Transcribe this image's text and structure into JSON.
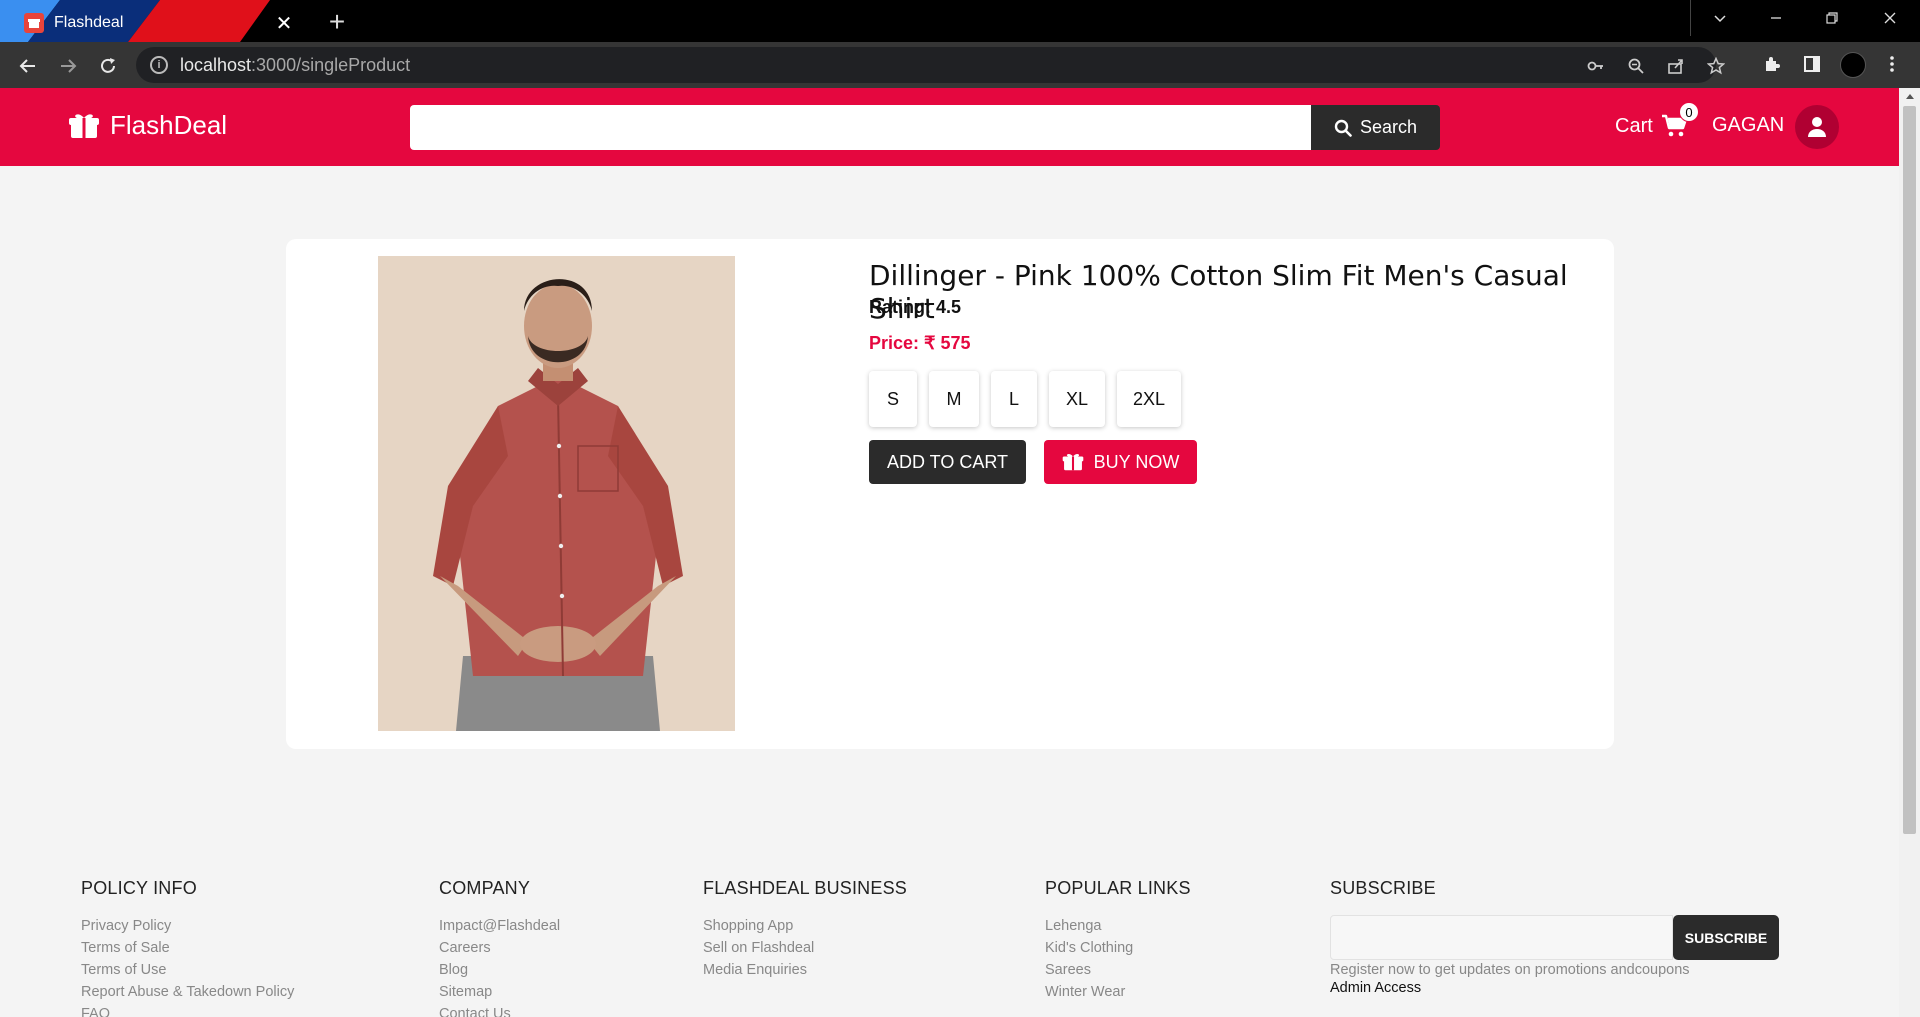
{
  "browser": {
    "tab_title": "Flashdeal",
    "url_host": "localhost",
    "url_path": ":3000/singleProduct",
    "close_glyph": "✕",
    "new_tab_glyph": "+"
  },
  "header": {
    "brand": "FlashDeal",
    "search_placeholder": "",
    "search_label": "Search",
    "cart_label": "Cart",
    "cart_count": "0",
    "user_name": "GAGAN"
  },
  "product": {
    "title": "Dillinger - Pink 100% Cotton Slim Fit Men's Casual Shirt",
    "rating": "Rating: 4.5",
    "price": "Price: ₹ 575",
    "sizes": [
      "S",
      "M",
      "L",
      "XL",
      "2XL"
    ],
    "add_to_cart": "ADD TO CART",
    "buy_now": "BUY NOW"
  },
  "footer": {
    "policy": {
      "heading": "POLICY INFO",
      "links": [
        "Privacy Policy",
        "Terms of Sale",
        "Terms of Use",
        "Report Abuse & Takedown Policy",
        "FAQ"
      ]
    },
    "company": {
      "heading": "COMPANY",
      "links": [
        "Impact@Flashdeal",
        "Careers",
        "Blog",
        "Sitemap",
        "Contact Us"
      ]
    },
    "business": {
      "heading": "FLASHDEAL BUSINESS",
      "links": [
        "Shopping App",
        "Sell on Flashdeal",
        "Media Enquiries"
      ]
    },
    "popular": {
      "heading": "POPULAR LINKS",
      "links": [
        "Lehenga",
        "Kid's Clothing",
        "Sarees",
        "Winter Wear"
      ]
    },
    "subscribe": {
      "heading": "SUBSCRIBE",
      "button": "SUBSCRIBE",
      "note": "Register now to get updates on promotions andcoupons",
      "admin": "Admin Access"
    }
  },
  "colors": {
    "brand": "#e5073f",
    "dark": "#2b2b2b"
  },
  "icons": [
    "search-icon",
    "cart-icon",
    "user-icon",
    "gift-icon",
    "key-icon",
    "zoom-icon",
    "share-icon",
    "star-icon",
    "extension-icon",
    "sidebar-icon",
    "menu-icon"
  ]
}
